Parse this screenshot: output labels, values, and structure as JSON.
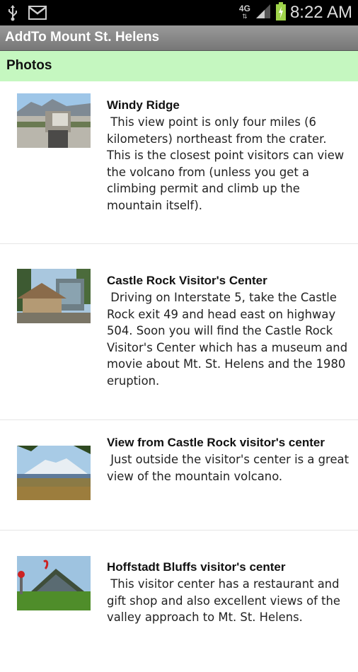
{
  "status_bar": {
    "network": "4G",
    "time": "8:22 AM"
  },
  "app": {
    "title": "AddTo Mount St. Helens"
  },
  "section": {
    "title": "Photos"
  },
  "items": [
    {
      "title": "Windy Ridge",
      "description": " This view point is only four miles (6 kilometers) northeast from the crater. This is the closest point visitors can view the volcano from (unless you get a climbing permit and climb up the mountain itself)."
    },
    {
      "title": "Castle Rock Visitor's Center",
      "description": " Driving on Interstate 5, take the Castle Rock exit 49 and head east on highway 504. Soon you will find the Castle Rock Visitor's Center which has a museum and movie about Mt. St. Helens and the 1980 eruption."
    },
    {
      "title": "View from Castle Rock visitor's center",
      "description": " Just outside the visitor's center is a great view of the mountain volcano."
    },
    {
      "title": "Hoffstadt Bluffs visitor's center",
      "description": " This visitor center has a restaurant and gift shop and also excellent views of the valley approach to Mt. St. Helens."
    }
  ]
}
